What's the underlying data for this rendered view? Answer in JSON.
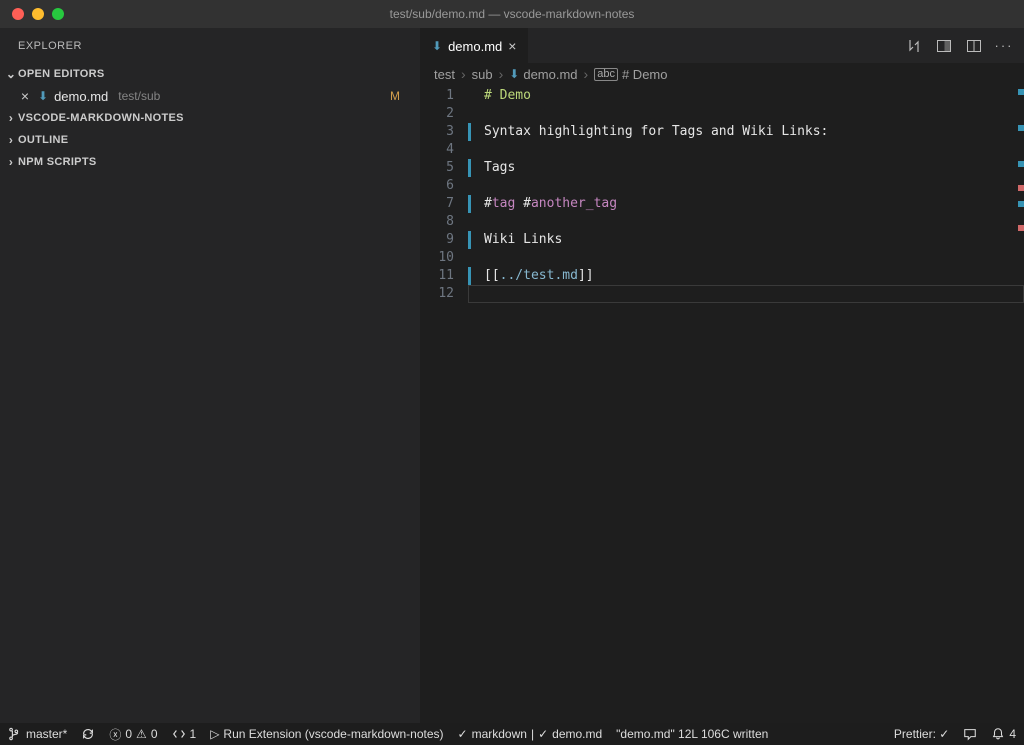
{
  "window": {
    "title": "test/sub/demo.md — vscode-markdown-notes"
  },
  "sidebar": {
    "title": "EXPLORER",
    "sections": {
      "open_editors": {
        "label": "OPEN EDITORS"
      },
      "workspace": {
        "label": "VSCODE-MARKDOWN-NOTES"
      },
      "outline": {
        "label": "OUTLINE"
      },
      "npm": {
        "label": "NPM SCRIPTS"
      }
    },
    "open_file": {
      "name": "demo.md",
      "path": "test/sub",
      "modified_badge": "M"
    }
  },
  "tab": {
    "label": "demo.md"
  },
  "breadcrumb": {
    "parts": [
      "test",
      "sub",
      "demo.md"
    ],
    "symbol": "# Demo"
  },
  "editor": {
    "lines": [
      {
        "n": 1,
        "diff": false,
        "segments": [
          [
            "# Demo",
            "hl-header"
          ]
        ]
      },
      {
        "n": 2,
        "diff": false,
        "segments": []
      },
      {
        "n": 3,
        "diff": true,
        "segments": [
          [
            "Syntax highlighting for Tags and Wiki Links:",
            "plain"
          ]
        ]
      },
      {
        "n": 4,
        "diff": false,
        "segments": []
      },
      {
        "n": 5,
        "diff": true,
        "segments": [
          [
            "Tags",
            "plain"
          ]
        ]
      },
      {
        "n": 6,
        "diff": false,
        "segments": []
      },
      {
        "n": 7,
        "diff": true,
        "segments": [
          [
            "#",
            "plain"
          ],
          [
            "tag",
            "hl-tag"
          ],
          [
            " #",
            "plain"
          ],
          [
            "another_tag",
            "hl-tag"
          ]
        ]
      },
      {
        "n": 8,
        "diff": false,
        "segments": []
      },
      {
        "n": 9,
        "diff": true,
        "segments": [
          [
            "Wiki Links",
            "plain"
          ]
        ]
      },
      {
        "n": 10,
        "diff": false,
        "segments": []
      },
      {
        "n": 11,
        "diff": true,
        "segments": [
          [
            "[[",
            "hl-punc"
          ],
          [
            "../test.md",
            "hl-link"
          ],
          [
            "]]",
            "hl-punc"
          ]
        ]
      },
      {
        "n": 12,
        "diff": false,
        "segments": [],
        "cursor": true
      }
    ]
  },
  "statusbar": {
    "branch": "master*",
    "errors": "0",
    "warnings": "0",
    "remote_count": "1",
    "run_target": "Run Extension (vscode-markdown-notes)",
    "language": "markdown",
    "linked_file": "demo.md",
    "message": "\"demo.md\" 12L 106C written",
    "prettier": "Prettier: ✓",
    "notifications": "4"
  }
}
